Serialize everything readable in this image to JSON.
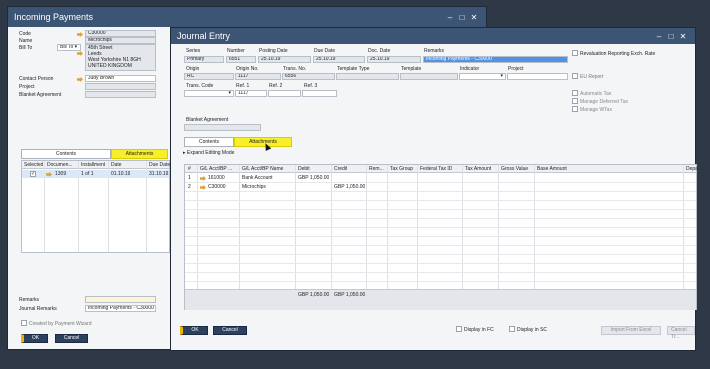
{
  "payments": {
    "title": "Incoming Payments",
    "code_label": "Code",
    "code_value": "C30000",
    "name_label": "Name",
    "name_value": "Microchips",
    "billto_label": "Bill To",
    "billto_select": "Bill To",
    "address": [
      "45th Street",
      "Leeds",
      "West Yorkshire N1 8GH",
      "UNITED KINGDOM"
    ],
    "contact_label": "Contact Person",
    "contact_value": "Judy Brown",
    "project_label": "Project",
    "blanket_label": "Blanket Agreement",
    "tabs": [
      "Contents",
      "Attachments"
    ],
    "grid_headers": [
      "Selected",
      "Documen...",
      "Installment",
      "Date",
      "Due Date"
    ],
    "grid_row": [
      "1309",
      "1 of 1",
      "01.10.19",
      "31.10.19"
    ],
    "remarks_label": "Remarks",
    "journal_remarks_label": "Journal Remarks",
    "journal_remarks_value": "Incoming Payments - C30000",
    "wizard_label": "Created by Payment Wizard",
    "ok": "OK",
    "cancel": "Cancel"
  },
  "journal": {
    "title": "Journal Entry",
    "hdr": {
      "series": "Series",
      "series_val": "Primary",
      "number": "Number",
      "number_val": "6551",
      "posting": "Posting Date",
      "posting_val": "25.10.19",
      "due": "Due Date",
      "due_val": "25.10.19",
      "doc": "Doc. Date",
      "doc_val": "25.10.19",
      "remarks": "Remarks",
      "remarks_val": "Incoming Payments - C30000",
      "origin": "Origin",
      "origin_val": "RC",
      "origin_no": "Origin No.",
      "origin_no_val": "1117",
      "trans_no": "Trans. No.",
      "trans_no_val": "6556",
      "template_type": "Template Type",
      "template": "Template",
      "indicator": "Indicator",
      "project": "Project",
      "trans_code": "Trans. Code",
      "ref1": "Ref. 1",
      "ref1_val": "1117",
      "ref2": "Ref. 2",
      "ref3": "Ref. 3",
      "blanket": "Blanket Agreement"
    },
    "side": {
      "reval": "Revaluation Reporting Exch. Rate",
      "eureport": "EU Report",
      "auto_tax": "Automatic Tax",
      "manage_deferred": "Manage Deferred Tax",
      "manage_wtax": "Manage WTax"
    },
    "tabs": [
      "Contents",
      "Attachments"
    ],
    "expand": "Expand Editing Mode",
    "grid_headers": [
      "#",
      "G/L Acct/BP ...",
      "G/L Acct/BP Name",
      "Debit",
      "Credit",
      "Rem...",
      "Tax Group",
      "Federal Tax ID",
      "Tax Amount",
      "Gross Value",
      "Base Amount",
      "Depa"
    ],
    "rows": [
      {
        "n": "1",
        "code": "161000",
        "name": "Bank Account",
        "debit": "GBP 1,050.00",
        "credit": ""
      },
      {
        "n": "2",
        "code": "C30000",
        "name": "Microchips",
        "debit": "",
        "credit": "GBP 1,050.00"
      }
    ],
    "total_debit": "GBP 1,050.00",
    "total_credit": "GBP 1,050.00",
    "display_fc": "Display in FC",
    "display_sc": "Display in SC",
    "import_excel": "Import From Excel",
    "cancel_r": "Cancel Tr...",
    "ok": "OK",
    "cancel": "Cancel"
  }
}
